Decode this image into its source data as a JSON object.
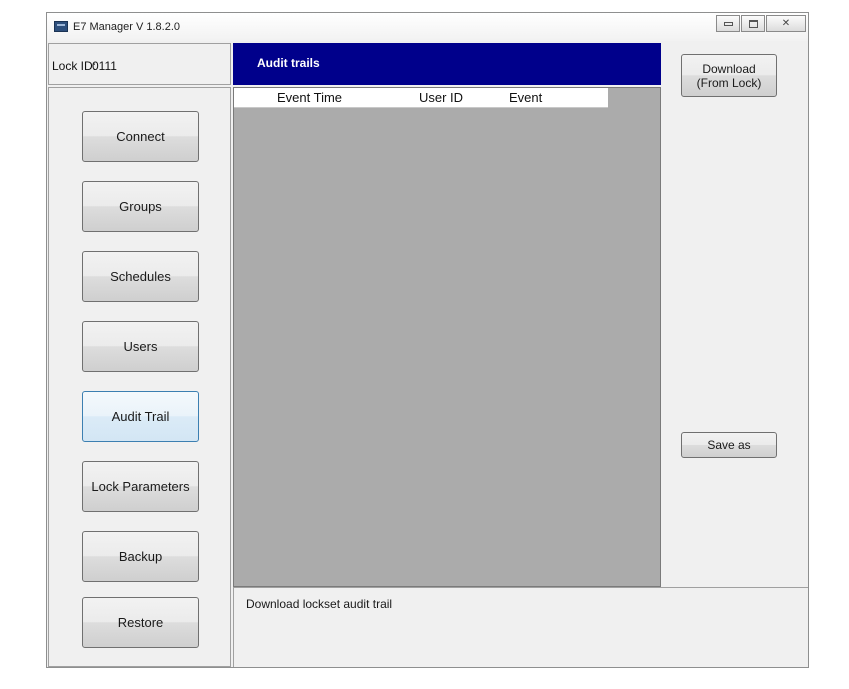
{
  "window": {
    "title": "E7 Manager V 1.8.2.0",
    "controls": {
      "close_glyph": "✕"
    }
  },
  "lock": {
    "label": "Lock ID:",
    "value": "0111"
  },
  "nav": {
    "items": [
      {
        "label": "Connect"
      },
      {
        "label": "Groups"
      },
      {
        "label": "Schedules"
      },
      {
        "label": "Users"
      },
      {
        "label": "Audit Trail",
        "active": true
      },
      {
        "label": "Lock Parameters"
      },
      {
        "label": "Backup"
      },
      {
        "label": "Restore"
      }
    ]
  },
  "panel": {
    "title": "Audit trails",
    "columns": [
      "Event Time",
      "User ID",
      "Event"
    ],
    "rows": []
  },
  "actions": {
    "download_line1": "Download",
    "download_line2": "(From Lock)",
    "save_as": "Save as"
  },
  "status": {
    "text": "Download lockset audit trail"
  },
  "colors": {
    "header_bg": "#00008b",
    "grid_bg": "#ababab",
    "window_bg": "#f0f0f0",
    "active_border": "#3c7fb1"
  }
}
